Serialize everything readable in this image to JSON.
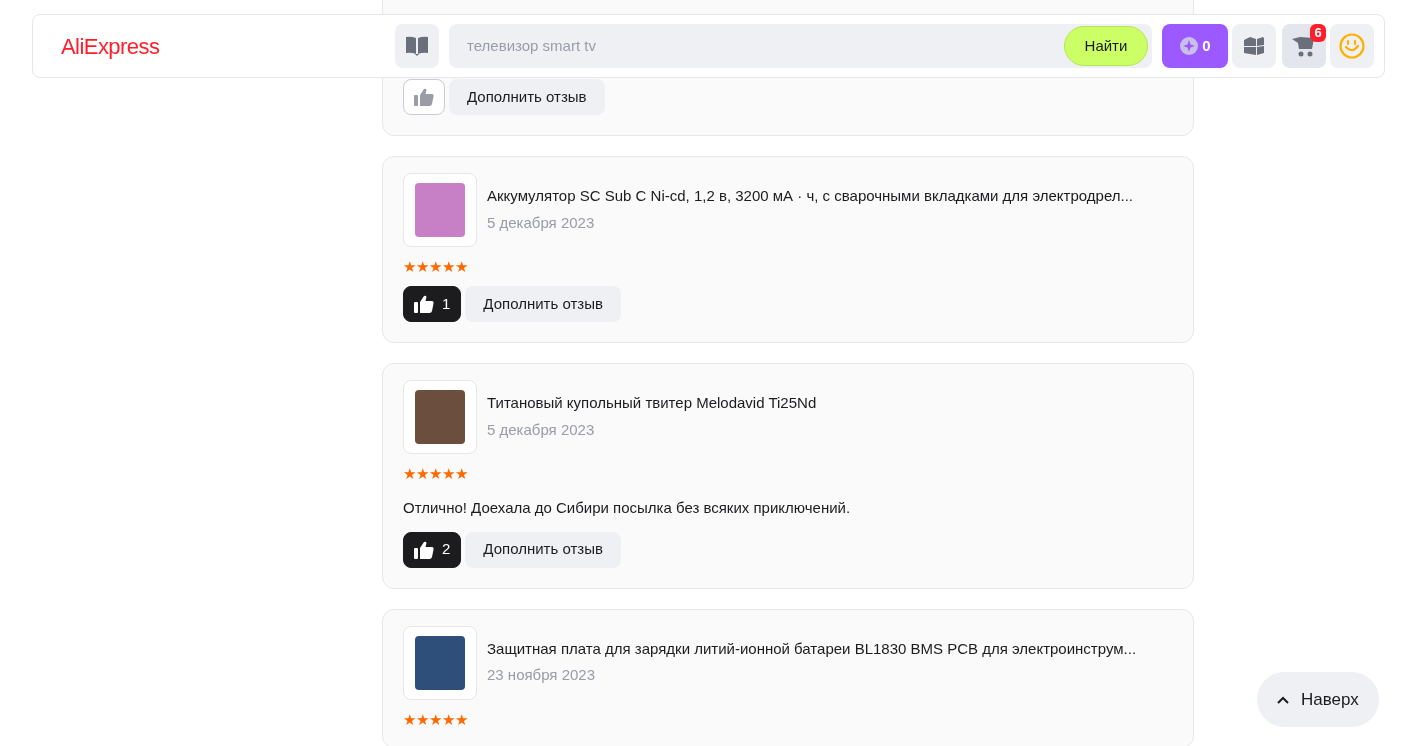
{
  "header": {
    "logo": "AliExpress",
    "search": {
      "placeholder": "телевизор smart tv"
    },
    "search_button": "Найти",
    "coins": "0",
    "cart_count": "6"
  },
  "reviews": [
    {
      "liked": false,
      "add_review": "Дополнить отзыв"
    },
    {
      "title": "Аккумулятор SC Sub C Ni-cd, 1,2 в, 3200 мА · ч, с сварочными вкладками для электродрел...",
      "date": "5 декабря 2023",
      "stars": 5,
      "liked": true,
      "likes": "1",
      "add_review": "Дополнить отзыв"
    },
    {
      "title": "Титановый купольный твитер Melodavid Ti25Nd",
      "date": "5 декабря 2023",
      "stars": 5,
      "text": "Отлично! Доехала до Сибири посылка без всяких приключений.",
      "liked": true,
      "likes": "2",
      "add_review": "Дополнить отзыв"
    },
    {
      "title": "Защитная плата для зарядки литий-ионной батареи BL1830 BMS PCB для электроинструм...",
      "date": "23 ноября 2023",
      "stars": 5
    }
  ],
  "back_to_top": "Наверх"
}
